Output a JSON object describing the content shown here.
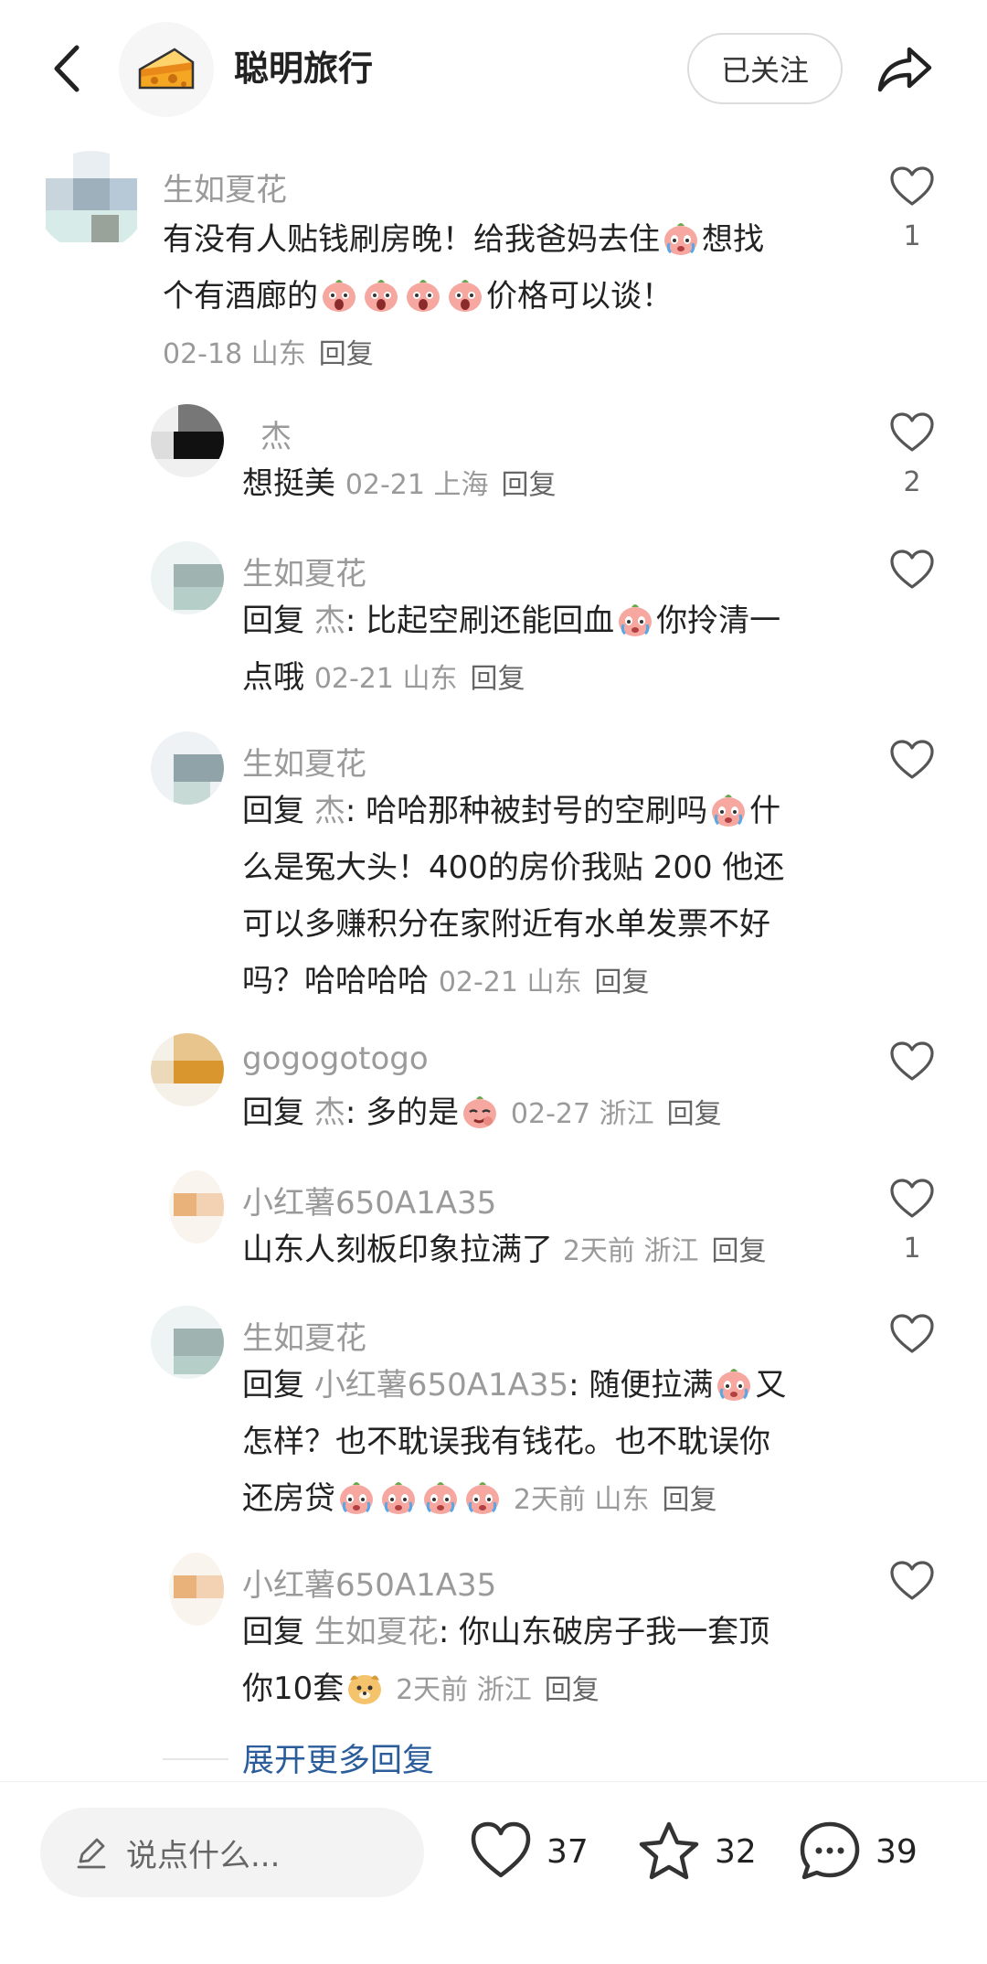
{
  "header": {
    "title": "聪明旅行",
    "follow_label": "已关注"
  },
  "comments": [
    {
      "name": "生如夏花",
      "text1": "有没有人贴钱刷房晚！给我爸妈去住",
      "text2": "想找",
      "text3": "个有酒廊的",
      "text4": "价格可以谈！",
      "date": "02-18",
      "location": "山东",
      "reply": "回复",
      "likes": "1"
    },
    {
      "name": "杰",
      "text1": "想挺美",
      "date": "02-21",
      "location": "上海",
      "reply": "回复",
      "likes": "2"
    },
    {
      "name": "生如夏花",
      "reply_prefix": "回复",
      "target": "杰",
      "text1": ": 比起空刷还能回血",
      "text2": "你拎清一",
      "text3": "点哦",
      "date": "02-21",
      "location": "山东",
      "reply": "回复",
      "likes": ""
    },
    {
      "name": "生如夏花",
      "reply_prefix": "回复",
      "target": "杰",
      "text1": ": 哈哈那种被封号的空刷吗",
      "text2": "什",
      "text3": "么是冤大头！400的房价我贴 200 他还",
      "text4": "可以多赚积分在家附近有水单发票不好",
      "text5": "吗？哈哈哈哈",
      "date": "02-21",
      "location": "山东",
      "reply": "回复",
      "likes": ""
    },
    {
      "name": "gogogotogo",
      "reply_prefix": "回复",
      "target": "杰",
      "text1": ": 多的是",
      "date": "02-27",
      "location": "浙江",
      "reply": "回复",
      "likes": ""
    },
    {
      "name": "小红薯650A1A35",
      "text1": "山东人刻板印象拉满了",
      "date": "2天前",
      "location": "浙江",
      "reply": "回复",
      "likes": "1"
    },
    {
      "name": "生如夏花",
      "reply_prefix": "回复",
      "target": "小红薯650A1A35",
      "text1": ": 随便拉满",
      "text2": "又",
      "text3": "怎样？也不耽误我有钱花。也不耽误你",
      "text4": "还房贷",
      "date": "2天前",
      "location": "山东",
      "reply": "回复",
      "likes": ""
    },
    {
      "name": "小红薯650A1A35",
      "reply_prefix": "回复",
      "target": "生如夏花",
      "text1": ": 你山东破房子我一套顶",
      "text2": "你10套",
      "date": "2天前",
      "location": "浙江",
      "reply": "回复",
      "likes": ""
    }
  ],
  "expand_label": "展开更多回复",
  "bottom": {
    "placeholder": "说点什么...",
    "likes": "37",
    "stars": "32",
    "comments": "39"
  },
  "colors": {
    "muted": "#9a9a9a",
    "link": "#2c5d9b",
    "emoji": "#f28b82"
  }
}
